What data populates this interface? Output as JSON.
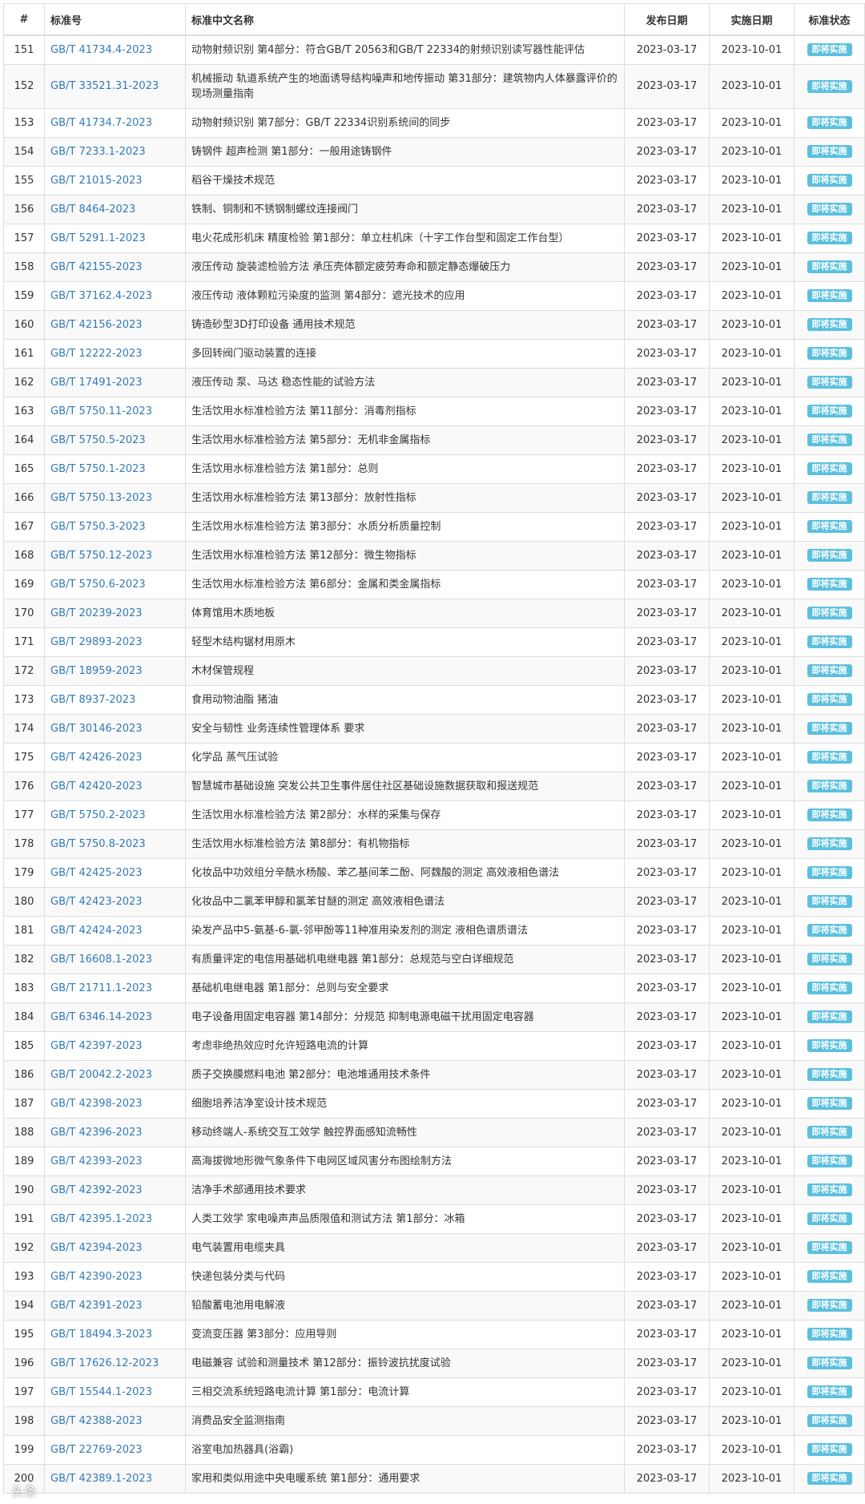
{
  "table": {
    "headers": [
      "#",
      "标准号",
      "标准中文名称",
      "发布日期",
      "实施日期",
      "标准状态"
    ],
    "rows": [
      {
        "num": "151",
        "code": "GB/T 41734.4-2023",
        "name": "动物射频识别 第4部分：符合GB/T 20563和GB/T 22334的射频识别读写器性能评估",
        "pub": "2023-03-17",
        "impl": "2023-10-01",
        "status": "即将实施"
      },
      {
        "num": "152",
        "code": "GB/T 33521.31-2023",
        "name": "机械振动 轨道系统产生的地面诱导结构噪声和地传振动 第31部分：建筑物内人体暴露评价的现场测量指南",
        "pub": "2023-03-17",
        "impl": "2023-10-01",
        "status": "即将实施"
      },
      {
        "num": "153",
        "code": "GB/T 41734.7-2023",
        "name": "动物射频识别 第7部分：GB/T 22334识别系统间的同步",
        "pub": "2023-03-17",
        "impl": "2023-10-01",
        "status": "即将实施"
      },
      {
        "num": "154",
        "code": "GB/T 7233.1-2023",
        "name": "铸钢件 超声检测 第1部分：一般用途铸钢件",
        "pub": "2023-03-17",
        "impl": "2023-10-01",
        "status": "即将实施"
      },
      {
        "num": "155",
        "code": "GB/T 21015-2023",
        "name": "稻谷干燥技术规范",
        "pub": "2023-03-17",
        "impl": "2023-10-01",
        "status": "即将实施"
      },
      {
        "num": "156",
        "code": "GB/T 8464-2023",
        "name": "铁制、铜制和不锈钢制螺纹连接阀门",
        "pub": "2023-03-17",
        "impl": "2023-10-01",
        "status": "即将实施"
      },
      {
        "num": "157",
        "code": "GB/T 5291.1-2023",
        "name": "电火花成形机床 精度检验 第1部分：单立柱机床（十字工作台型和固定工作台型）",
        "pub": "2023-03-17",
        "impl": "2023-10-01",
        "status": "即将实施"
      },
      {
        "num": "158",
        "code": "GB/T 42155-2023",
        "name": "液压传动 旋装滤检验方法 承压壳体额定疲劳寿命和额定静态爆破压力",
        "pub": "2023-03-17",
        "impl": "2023-10-01",
        "status": "即将实施"
      },
      {
        "num": "159",
        "code": "GB/T 37162.4-2023",
        "name": "液压传动 液体颗粒污染度的监测 第4部分：遮光技术的应用",
        "pub": "2023-03-17",
        "impl": "2023-10-01",
        "status": "即将实施"
      },
      {
        "num": "160",
        "code": "GB/T 42156-2023",
        "name": "铸造砂型3D打印设备 通用技术规范",
        "pub": "2023-03-17",
        "impl": "2023-10-01",
        "status": "即将实施"
      },
      {
        "num": "161",
        "code": "GB/T 12222-2023",
        "name": "多回转阀门驱动装置的连接",
        "pub": "2023-03-17",
        "impl": "2023-10-01",
        "status": "即将实施"
      },
      {
        "num": "162",
        "code": "GB/T 17491-2023",
        "name": "液压传动 泵、马达 稳态性能的试验方法",
        "pub": "2023-03-17",
        "impl": "2023-10-01",
        "status": "即将实施"
      },
      {
        "num": "163",
        "code": "GB/T 5750.11-2023",
        "name": "生活饮用水标准检验方法 第11部分：消毒剂指标",
        "pub": "2023-03-17",
        "impl": "2023-10-01",
        "status": "即将实施"
      },
      {
        "num": "164",
        "code": "GB/T 5750.5-2023",
        "name": "生活饮用水标准检验方法 第5部分：无机非金属指标",
        "pub": "2023-03-17",
        "impl": "2023-10-01",
        "status": "即将实施"
      },
      {
        "num": "165",
        "code": "GB/T 5750.1-2023",
        "name": "生活饮用水标准检验方法 第1部分：总则",
        "pub": "2023-03-17",
        "impl": "2023-10-01",
        "status": "即将实施"
      },
      {
        "num": "166",
        "code": "GB/T 5750.13-2023",
        "name": "生活饮用水标准检验方法 第13部分：放射性指标",
        "pub": "2023-03-17",
        "impl": "2023-10-01",
        "status": "即将实施"
      },
      {
        "num": "167",
        "code": "GB/T 5750.3-2023",
        "name": "生活饮用水标准检验方法 第3部分：水质分析质量控制",
        "pub": "2023-03-17",
        "impl": "2023-10-01",
        "status": "即将实施"
      },
      {
        "num": "168",
        "code": "GB/T 5750.12-2023",
        "name": "生活饮用水标准检验方法 第12部分：微生物指标",
        "pub": "2023-03-17",
        "impl": "2023-10-01",
        "status": "即将实施"
      },
      {
        "num": "169",
        "code": "GB/T 5750.6-2023",
        "name": "生活饮用水标准检验方法 第6部分：金属和类金属指标",
        "pub": "2023-03-17",
        "impl": "2023-10-01",
        "status": "即将实施"
      },
      {
        "num": "170",
        "code": "GB/T 20239-2023",
        "name": "体育馆用木质地板",
        "pub": "2023-03-17",
        "impl": "2023-10-01",
        "status": "即将实施"
      },
      {
        "num": "171",
        "code": "GB/T 29893-2023",
        "name": "轻型木结构锯材用原木",
        "pub": "2023-03-17",
        "impl": "2023-10-01",
        "status": "即将实施"
      },
      {
        "num": "172",
        "code": "GB/T 18959-2023",
        "name": "木材保管规程",
        "pub": "2023-03-17",
        "impl": "2023-10-01",
        "status": "即将实施"
      },
      {
        "num": "173",
        "code": "GB/T 8937-2023",
        "name": "食用动物油脂 猪油",
        "pub": "2023-03-17",
        "impl": "2023-10-01",
        "status": "即将实施"
      },
      {
        "num": "174",
        "code": "GB/T 30146-2023",
        "name": "安全与韧性 业务连续性管理体系 要求",
        "pub": "2023-03-17",
        "impl": "2023-10-01",
        "status": "即将实施"
      },
      {
        "num": "175",
        "code": "GB/T 42426-2023",
        "name": "化学品 蒸气压试验",
        "pub": "2023-03-17",
        "impl": "2023-10-01",
        "status": "即将实施"
      },
      {
        "num": "176",
        "code": "GB/T 42420-2023",
        "name": "智慧城市基础设施 突发公共卫生事件居住社区基础设施数据获取和报送规范",
        "pub": "2023-03-17",
        "impl": "2023-10-01",
        "status": "即将实施"
      },
      {
        "num": "177",
        "code": "GB/T 5750.2-2023",
        "name": "生活饮用水标准检验方法 第2部分：水样的采集与保存",
        "pub": "2023-03-17",
        "impl": "2023-10-01",
        "status": "即将实施"
      },
      {
        "num": "178",
        "code": "GB/T 5750.8-2023",
        "name": "生活饮用水标准检验方法 第8部分：有机物指标",
        "pub": "2023-03-17",
        "impl": "2023-10-01",
        "status": "即将实施"
      },
      {
        "num": "179",
        "code": "GB/T 42425-2023",
        "name": "化妆品中功效组分辛酰水杨酸、苯乙基间苯二酚、阿魏酸的测定 高效液相色谱法",
        "pub": "2023-03-17",
        "impl": "2023-10-01",
        "status": "即将实施"
      },
      {
        "num": "180",
        "code": "GB/T 42423-2023",
        "name": "化妆品中二氯苯甲醇和氯苯甘醚的测定 高效液相色谱法",
        "pub": "2023-03-17",
        "impl": "2023-10-01",
        "status": "即将实施"
      },
      {
        "num": "181",
        "code": "GB/T 42424-2023",
        "name": "染发产品中5-氨基-6-氯-邻甲酚等11种准用染发剂的测定 液相色谱质谱法",
        "pub": "2023-03-17",
        "impl": "2023-10-01",
        "status": "即将实施"
      },
      {
        "num": "182",
        "code": "GB/T 16608.1-2023",
        "name": "有质量评定的电信用基础机电继电器 第1部分：总规范与空白详细规范",
        "pub": "2023-03-17",
        "impl": "2023-10-01",
        "status": "即将实施"
      },
      {
        "num": "183",
        "code": "GB/T 21711.1-2023",
        "name": "基础机电继电器 第1部分：总则与安全要求",
        "pub": "2023-03-17",
        "impl": "2023-10-01",
        "status": "即将实施"
      },
      {
        "num": "184",
        "code": "GB/T 6346.14-2023",
        "name": "电子设备用固定电容器 第14部分：分规范 抑制电源电磁干扰用固定电容器",
        "pub": "2023-03-17",
        "impl": "2023-10-01",
        "status": "即将实施"
      },
      {
        "num": "185",
        "code": "GB/T 42397-2023",
        "name": "考虑非绝热效应时允许短路电流的计算",
        "pub": "2023-03-17",
        "impl": "2023-10-01",
        "status": "即将实施"
      },
      {
        "num": "186",
        "code": "GB/T 20042.2-2023",
        "name": "质子交换膜燃料电池 第2部分：电池堆通用技术条件",
        "pub": "2023-03-17",
        "impl": "2023-10-01",
        "status": "即将实施"
      },
      {
        "num": "187",
        "code": "GB/T 42398-2023",
        "name": "细胞培养洁净室设计技术规范",
        "pub": "2023-03-17",
        "impl": "2023-10-01",
        "status": "即将实施"
      },
      {
        "num": "188",
        "code": "GB/T 42396-2023",
        "name": "移动终端人-系统交互工效学 触控界面感知流畅性",
        "pub": "2023-03-17",
        "impl": "2023-10-01",
        "status": "即将实施"
      },
      {
        "num": "189",
        "code": "GB/T 42393-2023",
        "name": "高海拔微地形微气象条件下电网区域风害分布图绘制方法",
        "pub": "2023-03-17",
        "impl": "2023-10-01",
        "status": "即将实施"
      },
      {
        "num": "190",
        "code": "GB/T 42392-2023",
        "name": "洁净手术部通用技术要求",
        "pub": "2023-03-17",
        "impl": "2023-10-01",
        "status": "即将实施"
      },
      {
        "num": "191",
        "code": "GB/T 42395.1-2023",
        "name": "人类工效学 家电噪声声品质限值和测试方法 第1部分：冰箱",
        "pub": "2023-03-17",
        "impl": "2023-10-01",
        "status": "即将实施"
      },
      {
        "num": "192",
        "code": "GB/T 42394-2023",
        "name": "电气装置用电缆夹具",
        "pub": "2023-03-17",
        "impl": "2023-10-01",
        "status": "即将实施"
      },
      {
        "num": "193",
        "code": "GB/T 42390-2023",
        "name": "快递包装分类与代码",
        "pub": "2023-03-17",
        "impl": "2023-10-01",
        "status": "即将实施"
      },
      {
        "num": "194",
        "code": "GB/T 42391-2023",
        "name": "铅酸蓄电池用电解液",
        "pub": "2023-03-17",
        "impl": "2023-10-01",
        "status": "即将实施"
      },
      {
        "num": "195",
        "code": "GB/T 18494.3-2023",
        "name": "变流变压器 第3部分：应用导则",
        "pub": "2023-03-17",
        "impl": "2023-10-01",
        "status": "即将实施"
      },
      {
        "num": "196",
        "code": "GB/T 17626.12-2023",
        "name": "电磁兼容 试验和测量技术 第12部分：振铃波抗扰度试验",
        "pub": "2023-03-17",
        "impl": "2023-10-01",
        "status": "即将实施"
      },
      {
        "num": "197",
        "code": "GB/T 15544.1-2023",
        "name": "三相交流系统短路电流计算 第1部分：电流计算",
        "pub": "2023-03-17",
        "impl": "2023-10-01",
        "status": "即将实施"
      },
      {
        "num": "198",
        "code": "GB/T 42388-2023",
        "name": "消费品安全监测指南",
        "pub": "2023-03-17",
        "impl": "2023-10-01",
        "status": "即将实施"
      },
      {
        "num": "199",
        "code": "GB/T 22769-2023",
        "name": "浴室电加热器具(浴霸)",
        "pub": "2023-03-17",
        "impl": "2023-10-01",
        "status": "即将实施"
      },
      {
        "num": "200",
        "code": "GB/T 42389.1-2023",
        "name": "家用和类似用途中央电暖系统 第1部分：通用要求",
        "pub": "2023-03-17",
        "impl": "2023-10-01",
        "status": "即将实施"
      }
    ]
  },
  "colors": {
    "link": "#337ab7",
    "status_badge": "#5bc0de",
    "row_stripe": "#f9f9f9",
    "border": "#dddddd"
  }
}
